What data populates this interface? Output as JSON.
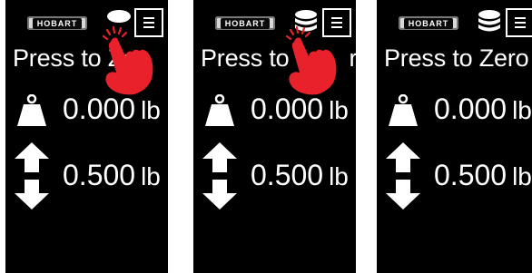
{
  "panels": [
    {
      "logo": "HOBART",
      "status_icon": "scale-indicator-oval",
      "press_label": "Press to Zero",
      "display_press_label": "Press to Ze    ro",
      "gross_value": "0.000",
      "gross_unit": "lb",
      "tare_value": "0.500",
      "tare_unit": "lb",
      "overlay": "tap-hand"
    },
    {
      "logo": "HOBART",
      "status_icon": "coin-stack-icon",
      "press_label": "Press to Zero",
      "display_press_label": "Press to    ro",
      "gross_value": "0.000",
      "gross_unit": "lb",
      "tare_value": "0.500",
      "tare_unit": "lb",
      "overlay": "tap-hand"
    },
    {
      "logo": "HOBART",
      "status_icon": "coin-stack-icon",
      "press_label": "Press to Zero",
      "gross_value": "0.000",
      "gross_unit": "lb",
      "tare_value": "0.500",
      "tare_unit": "lb",
      "overlay": ""
    }
  ],
  "colors": {
    "screen_bg": "#000000",
    "text": "#ffffff",
    "hand": "#e8212b",
    "page_bg": "#ffffff"
  }
}
